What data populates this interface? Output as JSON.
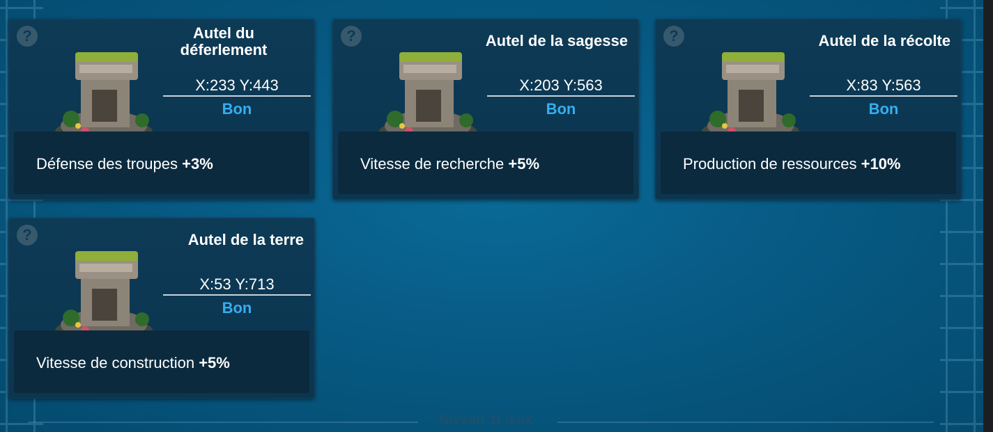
{
  "cards": [
    {
      "title": "Autel du déferlement",
      "title_line1": "Autel du",
      "title_line2": "déferlement",
      "coords": "X:233 Y:443",
      "status": "Bon",
      "bonus_label": "Défense des troupes",
      "bonus_value": "+3%"
    },
    {
      "title": "Autel de la sagesse",
      "coords": "X:203 Y:563",
      "status": "Bon",
      "bonus_label": "Vitesse de recherche",
      "bonus_value": "+5%"
    },
    {
      "title": "Autel de la récolte",
      "coords": "X:83 Y:563",
      "status": "Bon",
      "bonus_label": "Production de ressources",
      "bonus_value": "+10%"
    },
    {
      "title": "Autel de la terre",
      "coords": "X:53 Y:713",
      "status": "Bon",
      "bonus_label": "Vitesse de construction",
      "bonus_value": "+5%"
    }
  ],
  "help_icon": "?",
  "icons": {
    "help": "question-mark-icon",
    "altar": "altar-icon"
  },
  "colors": {
    "status": "#36aef1",
    "card_bg": "#0d3a55",
    "bonus_bg": "#0b2a3e"
  },
  "footer": "Niveau 1Lieux"
}
